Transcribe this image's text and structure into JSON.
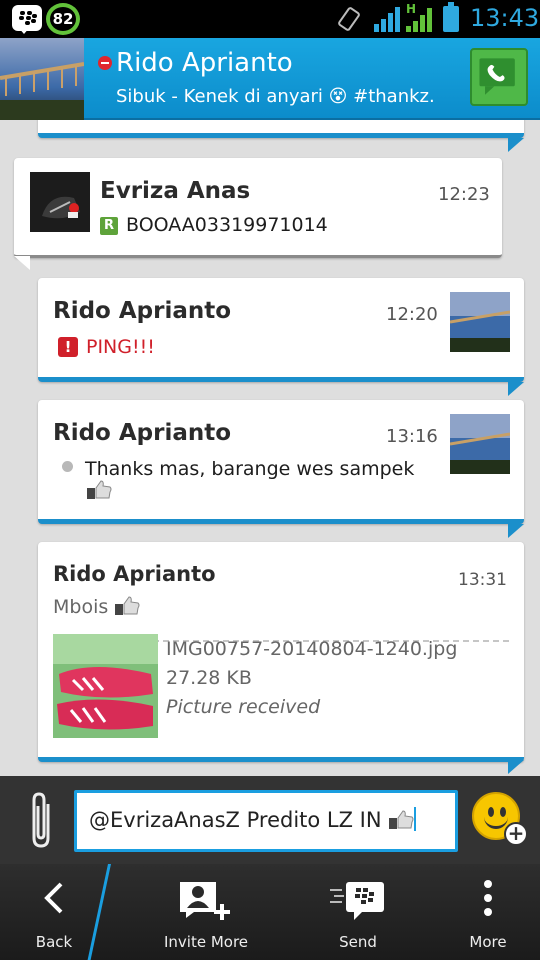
{
  "status_bar": {
    "battery_percent": "82",
    "network_type": "H",
    "time": "13:43",
    "icons": [
      "bbm-icon",
      "battery-ring-icon",
      "screen-rotation-icon",
      "signal-icon",
      "battery-icon"
    ]
  },
  "header": {
    "contact_name": "Rido Aprianto",
    "status_message": "Sibuk - Kenek di anyari 😵 #thankz...",
    "presence": "busy",
    "accent_color": "#1aa3df",
    "call_button_color": "#4fb848"
  },
  "messages": [
    {
      "sender": "Evriza Anas",
      "time": "12:23",
      "text": "BOOAA03319971014",
      "prefix_icon": "pin-icon",
      "prefix_label": "R",
      "direction": "incoming"
    },
    {
      "sender": "Rido Aprianto",
      "time": "12:20",
      "text": "PING!!!",
      "prefix_icon": "ping-icon",
      "prefix_label": "!",
      "direction": "outgoing"
    },
    {
      "sender": "Rido Aprianto",
      "time": "13:16",
      "text": "Thanks mas, barange wes sampek",
      "extra_icon": "thumbs-up-icon",
      "direction": "outgoing"
    },
    {
      "sender": "Rido Aprianto",
      "time": "13:31",
      "text": "Mbois",
      "extra_icon": "thumbs-up-icon",
      "attachment": {
        "file_name": "IMG00757-20140804-1240.jpg",
        "file_size": "27.28 KB",
        "status": "Picture received"
      },
      "direction": "outgoing"
    }
  ],
  "compose": {
    "value": "@EvrizaAnasZ Predito LZ IN",
    "extra_icon": "thumbs-up-icon"
  },
  "actions": [
    {
      "label": "Back",
      "icon": "back-icon"
    },
    {
      "label": "Invite More",
      "icon": "invite-more-icon"
    },
    {
      "label": "Send",
      "icon": "send-icon"
    },
    {
      "label": "More",
      "icon": "more-icon"
    }
  ]
}
